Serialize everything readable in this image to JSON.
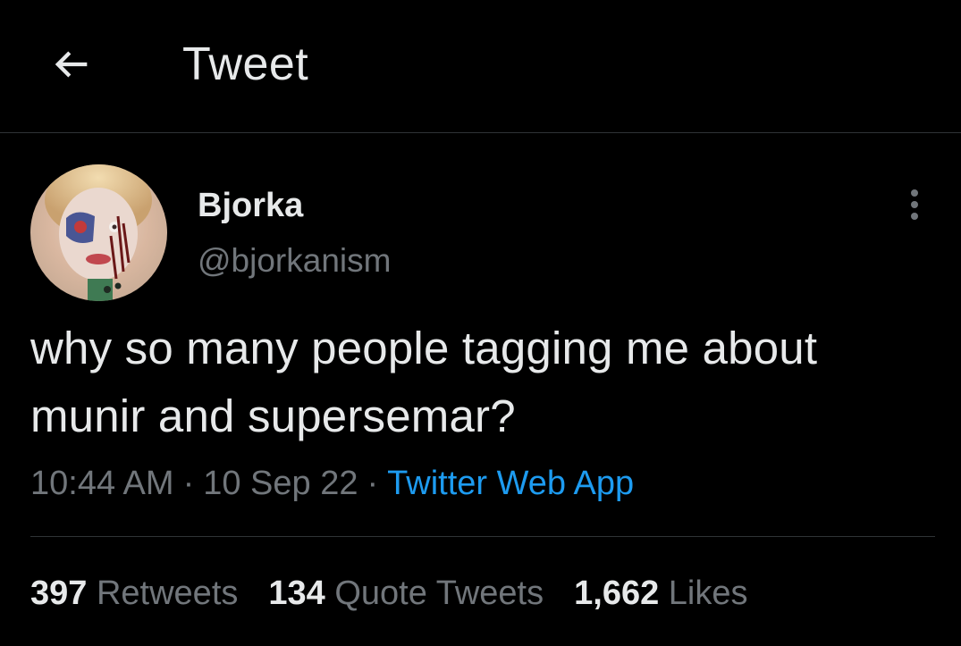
{
  "header": {
    "title": "Tweet",
    "back_icon": "arrow-left-icon"
  },
  "author": {
    "display_name": "Bjorka",
    "handle": "@bjorkanism"
  },
  "tweet": {
    "text": "why so many people tagging me about munir and supersemar?",
    "time": "10:44 AM",
    "date": "10 Sep 22",
    "separator": "·",
    "source": "Twitter Web App"
  },
  "stats": {
    "retweets_count": "397",
    "retweets_label": "Retweets",
    "quotes_count": "134",
    "quotes_label": "Quote Tweets",
    "likes_count": "1,662",
    "likes_label": "Likes"
  },
  "colors": {
    "background": "#000000",
    "primary_text": "#e7e9ea",
    "secondary_text": "#71767b",
    "link": "#1d9bf0",
    "border": "#2f3336"
  }
}
